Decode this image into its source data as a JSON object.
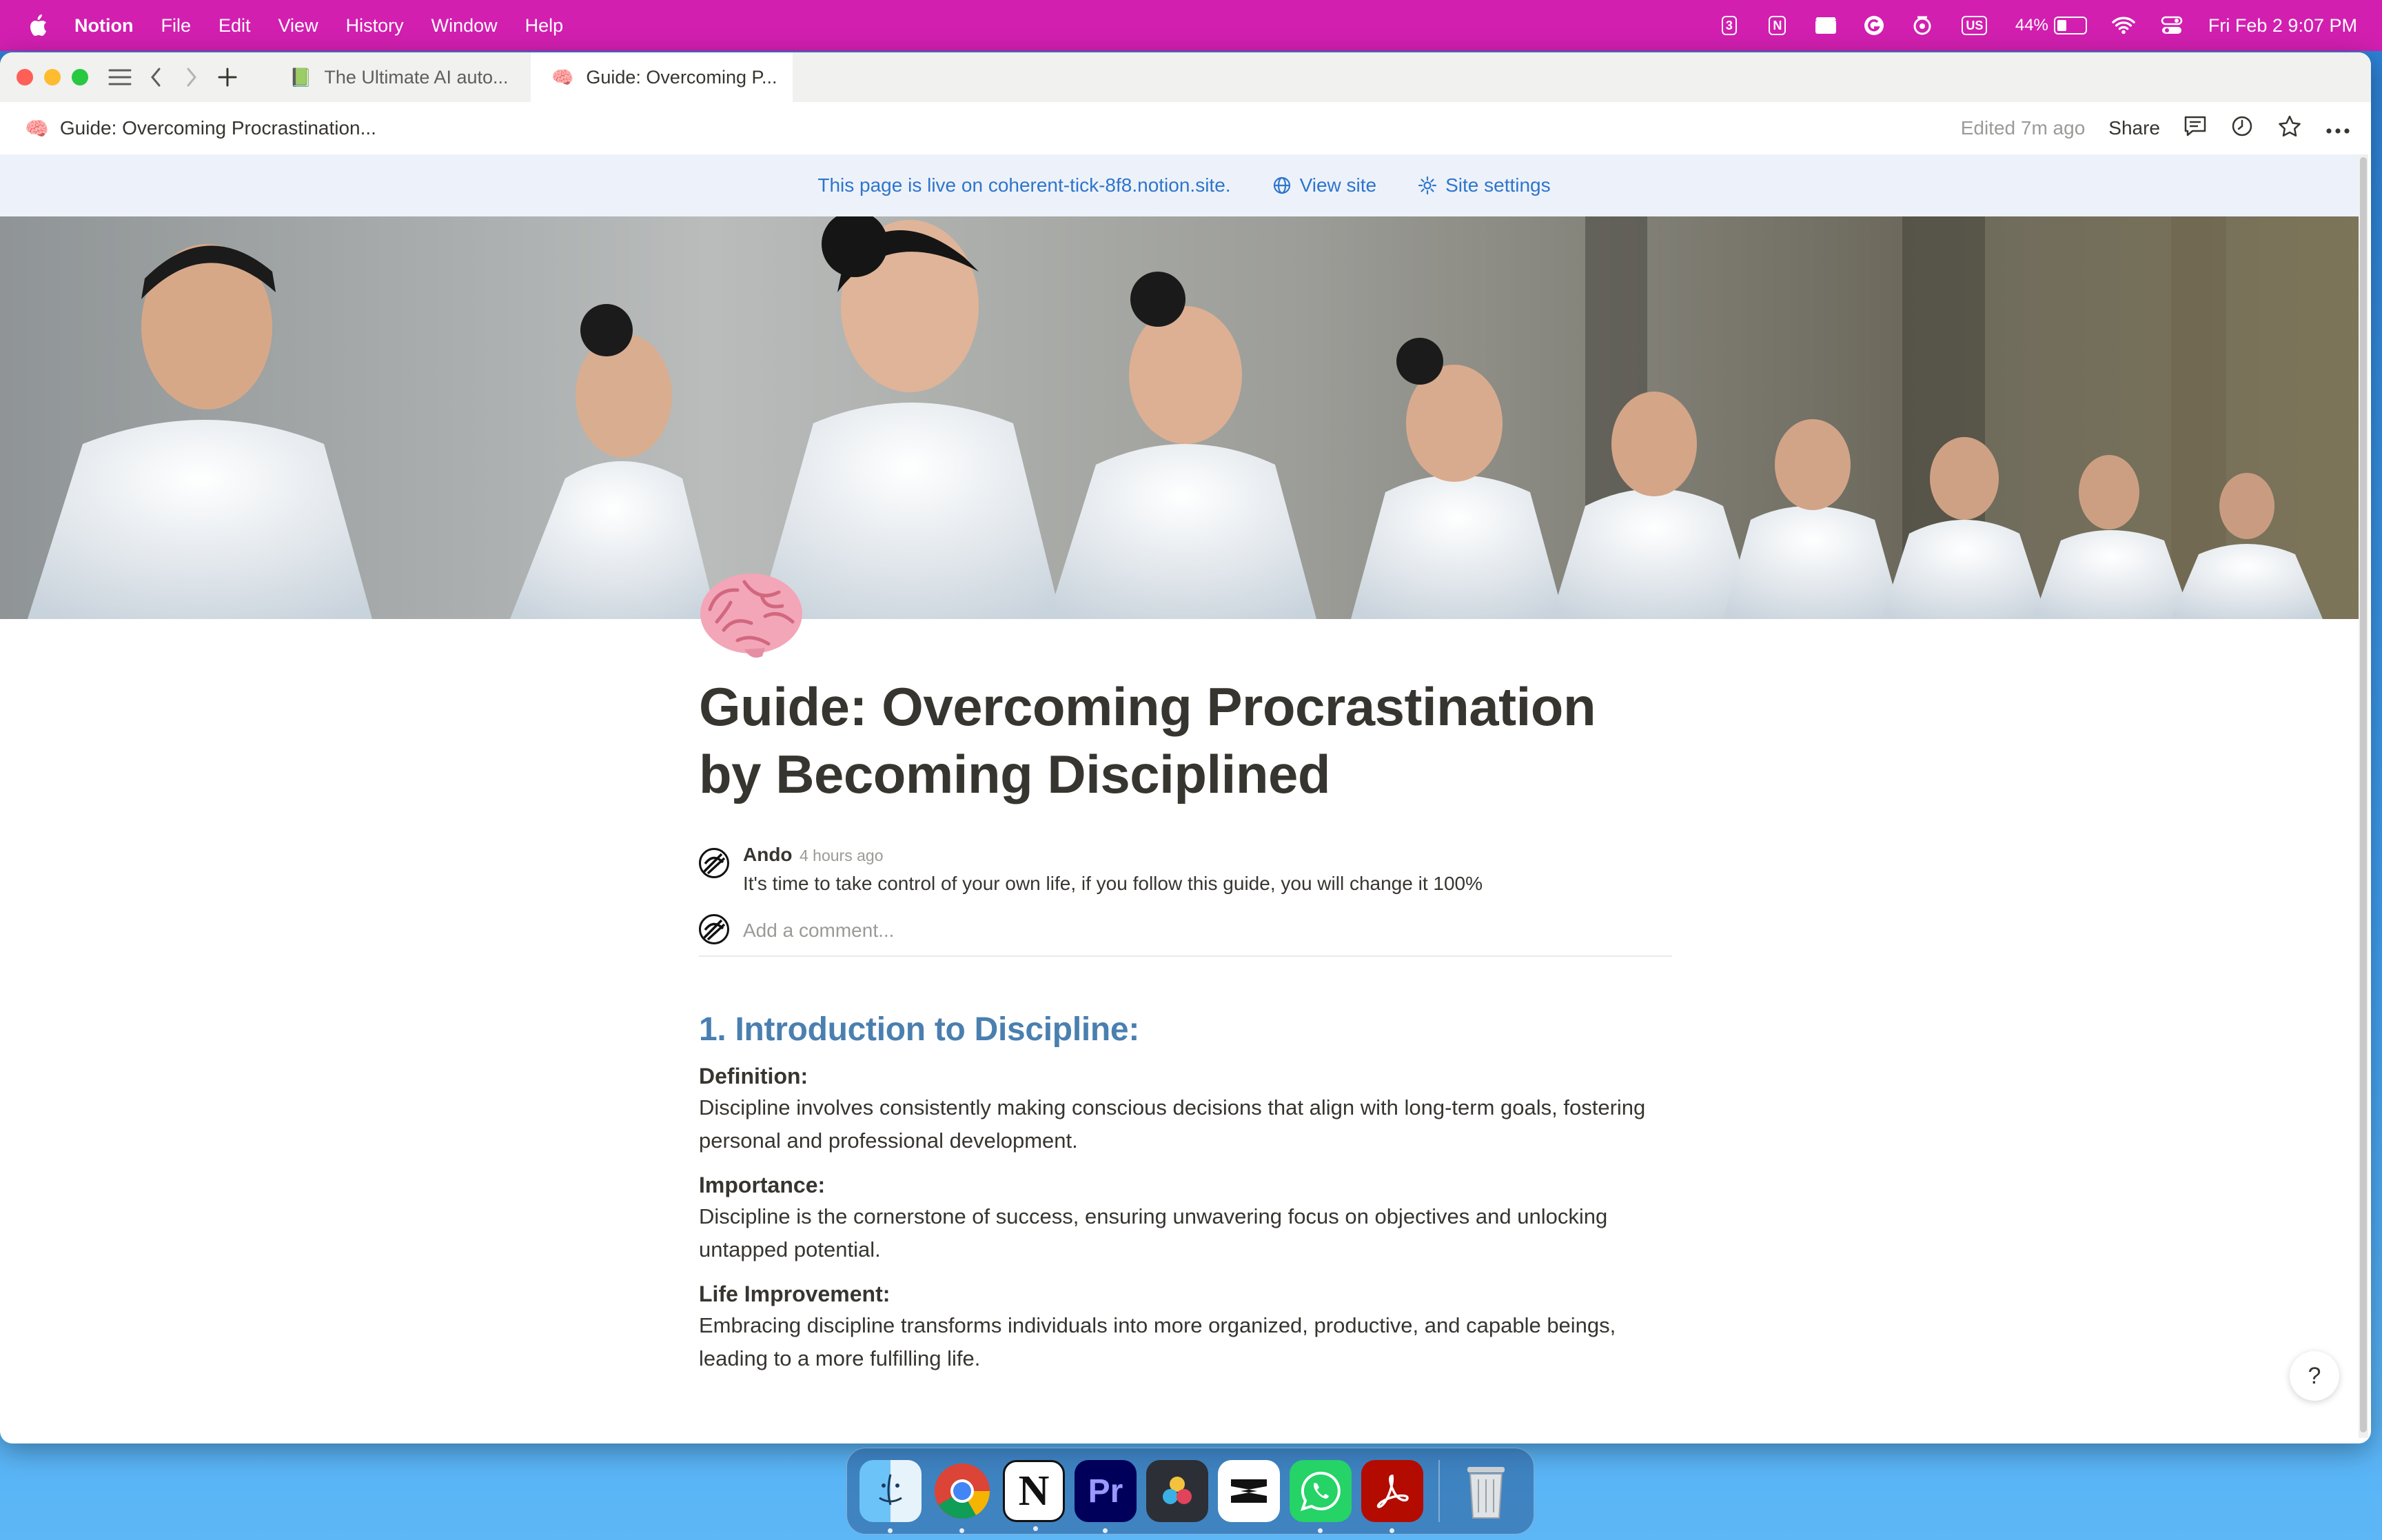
{
  "menubar": {
    "app_name": "Notion",
    "items": [
      "File",
      "Edit",
      "View",
      "History",
      "Window",
      "Help"
    ],
    "status": {
      "calendar_badge": "3",
      "notion_badge": "N",
      "keyboard": "US",
      "battery_percent": "44%",
      "battery_level": 0.44,
      "datetime": "Fri Feb 2  9:07 PM"
    }
  },
  "tabs": [
    {
      "emoji": "📗",
      "label": "The Ultimate AI auto..."
    },
    {
      "emoji": "🧠",
      "label": "Guide: Overcoming P..."
    }
  ],
  "topbar": {
    "breadcrumb_emoji": "🧠",
    "breadcrumb": "Guide: Overcoming Procrastination...",
    "edited": "Edited 7m ago",
    "share": "Share"
  },
  "banner": {
    "live_text": "This page is live on coherent-tick-8f8.notion.site.",
    "view_site": "View site",
    "site_settings": "Site settings"
  },
  "page": {
    "title": "Guide: Overcoming Procrastination by Becoming Disciplined",
    "comment": {
      "author": "Ando",
      "time": "4 hours ago",
      "text": "It's time to take control of your own life, if you follow this guide, you will change it 100%"
    },
    "add_comment_placeholder": "Add a comment...",
    "section": {
      "heading": "1. Introduction to Discipline:",
      "blocks": [
        {
          "label": "Definition:",
          "text": "Discipline involves consistently making conscious decisions that align with long-term goals, fostering personal and professional development."
        },
        {
          "label": "Importance:",
          "text": "Discipline is the cornerstone of success, ensuring unwavering focus on objectives and unlocking untapped potential."
        },
        {
          "label": "Life Improvement:",
          "text": "Embracing discipline transforms individuals into more organized, productive, and capable beings, leading to a more fulfilling life."
        }
      ]
    }
  },
  "help_label": "?",
  "dock": {
    "apps": [
      "finder-icon",
      "chrome-icon",
      "notion-icon",
      "premiere-pro-icon",
      "davinci-resolve-icon",
      "capcut-icon",
      "whatsapp-icon",
      "acrobat-icon",
      "trash-icon"
    ],
    "premiere_label": "Pr"
  }
}
